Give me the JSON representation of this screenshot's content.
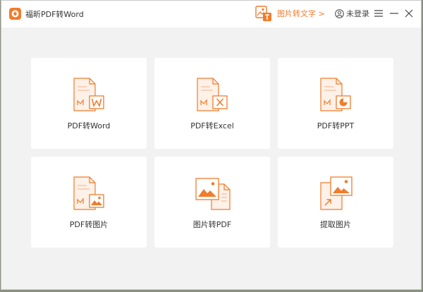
{
  "app": {
    "title": "福昕PDF转Word",
    "logo_icon": "foxit-logo-icon",
    "accent_color": "#f07c2c"
  },
  "header": {
    "image_to_text_label": "图片转文字 >",
    "login_label": "未登录"
  },
  "cards": [
    {
      "label": "PDF转Word",
      "icon": "pdf-to-word-icon"
    },
    {
      "label": "PDF转Excel",
      "icon": "pdf-to-excel-icon"
    },
    {
      "label": "PDF转PPT",
      "icon": "pdf-to-ppt-icon"
    },
    {
      "label": "PDF转图片",
      "icon": "pdf-to-image-icon"
    },
    {
      "label": "图片转PDF",
      "icon": "image-to-pdf-icon"
    },
    {
      "label": "提取图片",
      "icon": "extract-image-icon"
    }
  ]
}
